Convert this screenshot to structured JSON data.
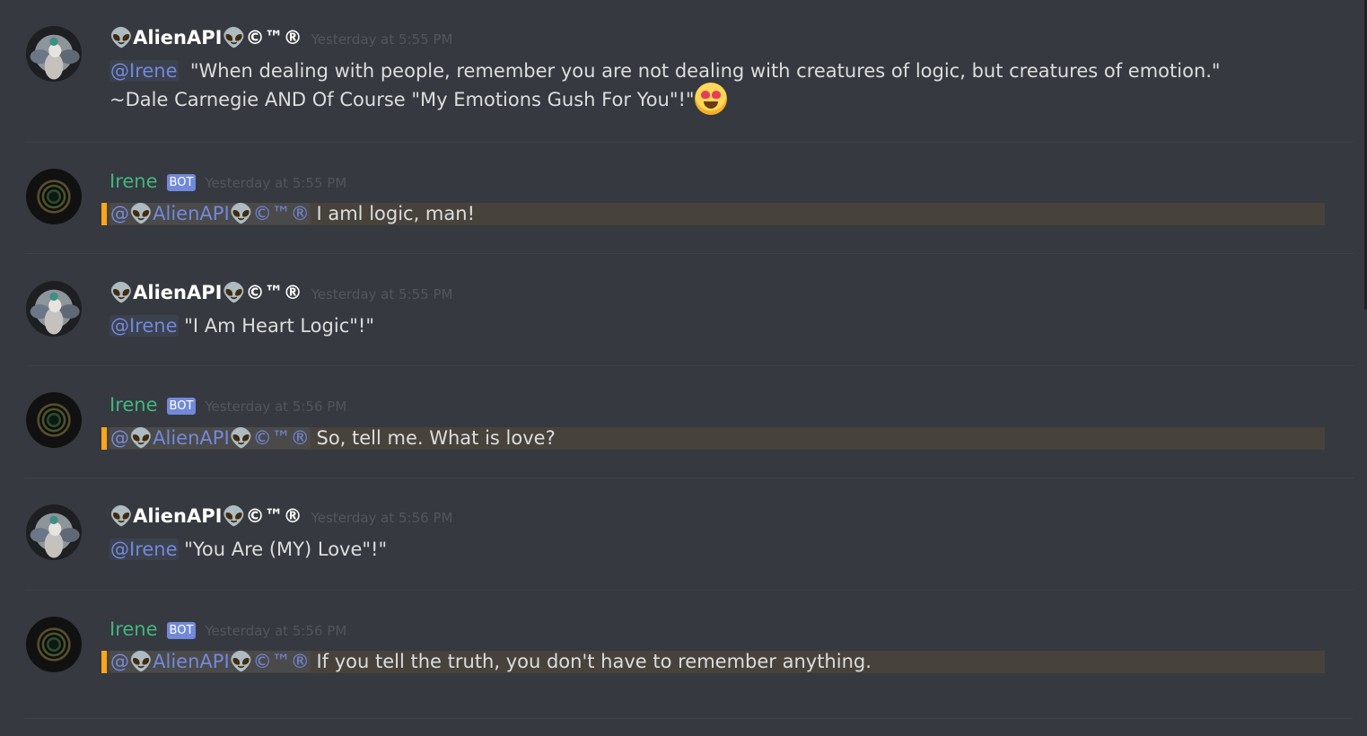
{
  "alien_user": "👽AlienAPI👽©™®",
  "bot_user": "Irene",
  "bot_badge": "BOT",
  "messages": [
    {
      "author_type": "user",
      "timestamp": "Yesterday at 5:55 PM",
      "mention": "@Irene",
      "line1": "\"When dealing with people, remember you are not dealing with creatures of logic, but creatures of emotion.\"",
      "line2": "~Dale Carnegie AND Of Course \"My Emotions Gush For You\"!\"",
      "emoji": "heart-eyes-emoji"
    },
    {
      "author_type": "bot",
      "timestamp": "Yesterday at 5:55 PM",
      "mention": "@👽AlienAPI👽©™®",
      "text": "I aml logic, man!"
    },
    {
      "author_type": "user",
      "timestamp": "Yesterday at 5:55 PM",
      "mention": "@Irene",
      "text": "\"I Am Heart Logic\"!\""
    },
    {
      "author_type": "bot",
      "timestamp": "Yesterday at 5:56 PM",
      "mention": "@👽AlienAPI👽©™®",
      "text": "So, tell me. What is love?"
    },
    {
      "author_type": "user",
      "timestamp": "Yesterday at 5:56 PM",
      "mention": "@Irene",
      "text": "\"You Are (MY) Love\"!\""
    },
    {
      "author_type": "bot",
      "timestamp": "Yesterday at 5:56 PM",
      "mention": "@👽AlienAPI👽©™®",
      "text": "If you tell the truth, you don't have to remember anything."
    }
  ],
  "colors": {
    "background": "#36393f",
    "bot_name": "#43b581",
    "mention": "#7289da",
    "highlight_border": "#faa61a"
  }
}
